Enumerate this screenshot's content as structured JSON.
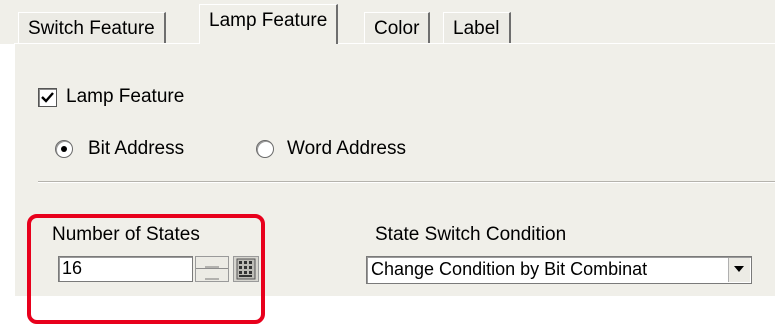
{
  "tabs": [
    {
      "label": "Switch Feature",
      "active": false
    },
    {
      "label": "Lamp Feature",
      "active": true
    },
    {
      "label": "Color",
      "active": false
    },
    {
      "label": "Label",
      "active": false
    }
  ],
  "lamp_feature": {
    "label": "Lamp Feature",
    "checked": true
  },
  "address_type": {
    "bit_label": "Bit Address",
    "word_label": "Word Address",
    "selected": "Bit Address"
  },
  "states": {
    "label": "Number of States",
    "value": "16"
  },
  "switch_condition": {
    "label": "State Switch Condition",
    "value": "Change Condition by Bit Combinat"
  },
  "colors": {
    "highlight": "#e8001c",
    "panel": "#f0efe9"
  }
}
